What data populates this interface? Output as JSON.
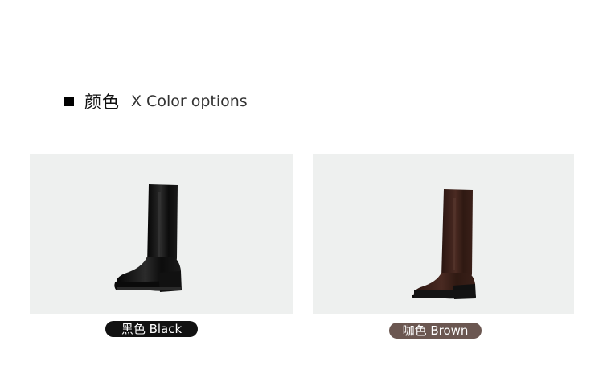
{
  "heading": {
    "title_cn": "颜色",
    "title_en": "X Color options"
  },
  "products": [
    {
      "label": "黑色 Black",
      "color": "#111111",
      "boot_color": "#121212"
    },
    {
      "label": "咖色 Brown",
      "color": "#6b5751",
      "boot_color": "#3a1f19"
    }
  ],
  "colors": {
    "card_bg": "#eef0ef",
    "heading_square": "#000000"
  }
}
